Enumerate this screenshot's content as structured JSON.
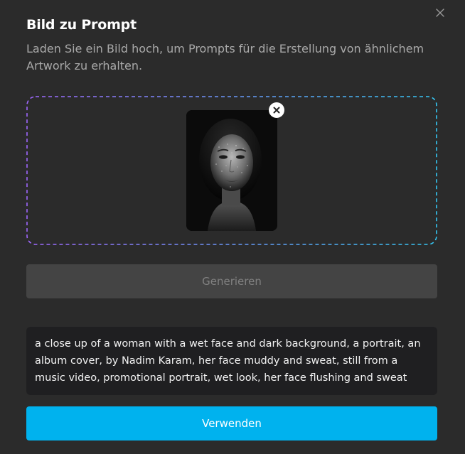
{
  "dialog": {
    "title": "Bild zu Prompt",
    "subtitle": "Laden Sie ein Bild hoch, um Prompts für die Erstellung von ähnlichem Artwork zu erhalten.",
    "close_icon": "close-icon"
  },
  "upload": {
    "border_gradient": [
      "#a067ff",
      "#34c8f5"
    ],
    "thumbnail": "uploaded-portrait-image",
    "remove_icon": "remove-x-icon"
  },
  "actions": {
    "generate_label": "Generieren",
    "use_label": "Verwenden"
  },
  "result": {
    "prompt_text": "a close up of a woman with a wet face and dark background, a portrait, an album cover, by Nadim Karam, her face muddy and sweat, still from a music video, promotional portrait, wet look, her face flushing and sweat"
  },
  "colors": {
    "background": "#2b2b2b",
    "accent": "#00b2ee",
    "disabled_button": "#444444",
    "result_background": "#1f1f21"
  }
}
